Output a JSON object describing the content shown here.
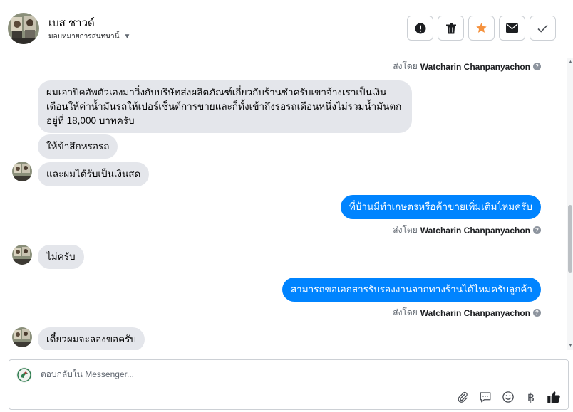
{
  "header": {
    "contact_name": "เบส ชาวด์",
    "assign_label": "มอบหมายการสนทนานี้",
    "actions": [
      {
        "name": "report-button",
        "icon": "alert-circle-icon"
      },
      {
        "name": "delete-button",
        "icon": "trash-icon"
      },
      {
        "name": "star-button",
        "icon": "star-icon"
      },
      {
        "name": "mark-unread-button",
        "icon": "envelope-icon"
      },
      {
        "name": "mark-done-button",
        "icon": "checkmark-icon"
      }
    ]
  },
  "thread": {
    "sent_by_prefix": "ส่งโดย",
    "sender_name": "Watcharin Chanpanyachon",
    "messages": [
      {
        "direction": "in",
        "text_lines": [
          "ผมเอาปิคอัพตัวเองมาวิ่งกับบริษัทส่งผลิตภัณฑ์เกี่ยวกับร้านชำครับเขาจ้างเราเป็นเงิน",
          "เดือนให้ค่าน้ำมันรถให้เปอร์เซ็นต์การขายและก็ทั้งเข้าถึงรอรถเดือนหนึ่งไม่รวมน้ำมันตก",
          "อยู่ที่ 18,000 บาทครับ"
        ]
      },
      {
        "direction": "in",
        "text": "ให้ข้าสึกหรอรถ"
      },
      {
        "direction": "in",
        "text": "และผมได้รับเป็นเงินสด"
      },
      {
        "direction": "out",
        "text": "ที่บ้านมีทำเกษตรหรือค้าขายเพิ่มเติมไหมครับ"
      },
      {
        "direction": "in",
        "text": "ไม่ครับ"
      },
      {
        "direction": "out",
        "text": "สามารถขอเอกสารรับรองงานจากทางร้านได้ไหมครับลูกค้า"
      },
      {
        "direction": "in",
        "text": "เดี๋ยวผมจะลองขอครับ"
      }
    ]
  },
  "composer": {
    "placeholder": "ตอบกลับใน Messenger...",
    "tools": [
      "paperclip-icon",
      "chat-bubble-icon",
      "emoji-icon",
      "baht-icon",
      "thumbs-up-icon"
    ],
    "baht_symbol": "฿"
  },
  "colors": {
    "outgoing_bubble": "#0084ff",
    "incoming_bubble": "#e4e6eb",
    "star": "#f5923e"
  }
}
